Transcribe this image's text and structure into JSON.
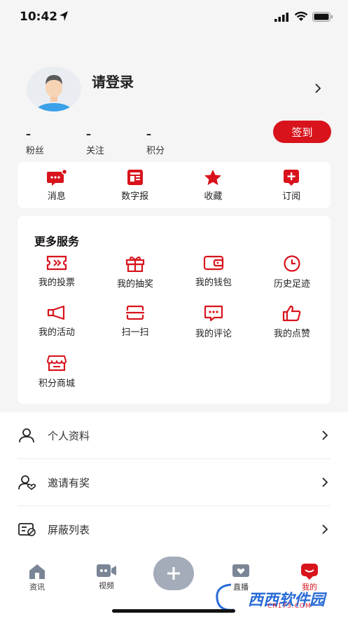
{
  "status": {
    "time": "10:42"
  },
  "profile": {
    "login_text": "请登录"
  },
  "stats": [
    {
      "value": "–",
      "label": "粉丝"
    },
    {
      "value": "–",
      "label": "关注"
    },
    {
      "value": "–",
      "label": "积分"
    }
  ],
  "signin_label": "签到",
  "quick": [
    {
      "label": "消息",
      "icon": "message-icon"
    },
    {
      "label": "数字报",
      "icon": "newspaper-icon"
    },
    {
      "label": "收藏",
      "icon": "star-icon"
    },
    {
      "label": "订阅",
      "icon": "subscribe-icon"
    }
  ],
  "services": {
    "title": "更多服务",
    "items": [
      {
        "label": "我的投票",
        "icon": "ticket-icon"
      },
      {
        "label": "我的抽奖",
        "icon": "gift-icon"
      },
      {
        "label": "我的钱包",
        "icon": "wallet-icon"
      },
      {
        "label": "历史足迹",
        "icon": "clock-icon"
      },
      {
        "label": "我的活动",
        "icon": "megaphone-icon"
      },
      {
        "label": "扫一扫",
        "icon": "scan-icon"
      },
      {
        "label": "我的评论",
        "icon": "comment-icon"
      },
      {
        "label": "我的点赞",
        "icon": "thumbs-up-icon"
      },
      {
        "label": "积分商城",
        "icon": "shop-icon"
      }
    ]
  },
  "menu": [
    {
      "label": "个人资料",
      "icon": "user-icon"
    },
    {
      "label": "邀请有奖",
      "icon": "invite-user-icon"
    },
    {
      "label": "屏蔽列表",
      "icon": "block-list-icon"
    }
  ],
  "tabs": [
    {
      "label": "资讯",
      "icon": "home-icon"
    },
    {
      "label": "视频",
      "icon": "video-icon"
    },
    {
      "label": "直播",
      "icon": "live-tv-icon"
    },
    {
      "label": "我的",
      "icon": "me-icon",
      "active": true
    }
  ],
  "watermark": {
    "text": "西西软件园",
    "sub": "CR173.COM"
  },
  "colors": {
    "accent": "#d8131c",
    "plus_button": "#a4acba"
  }
}
